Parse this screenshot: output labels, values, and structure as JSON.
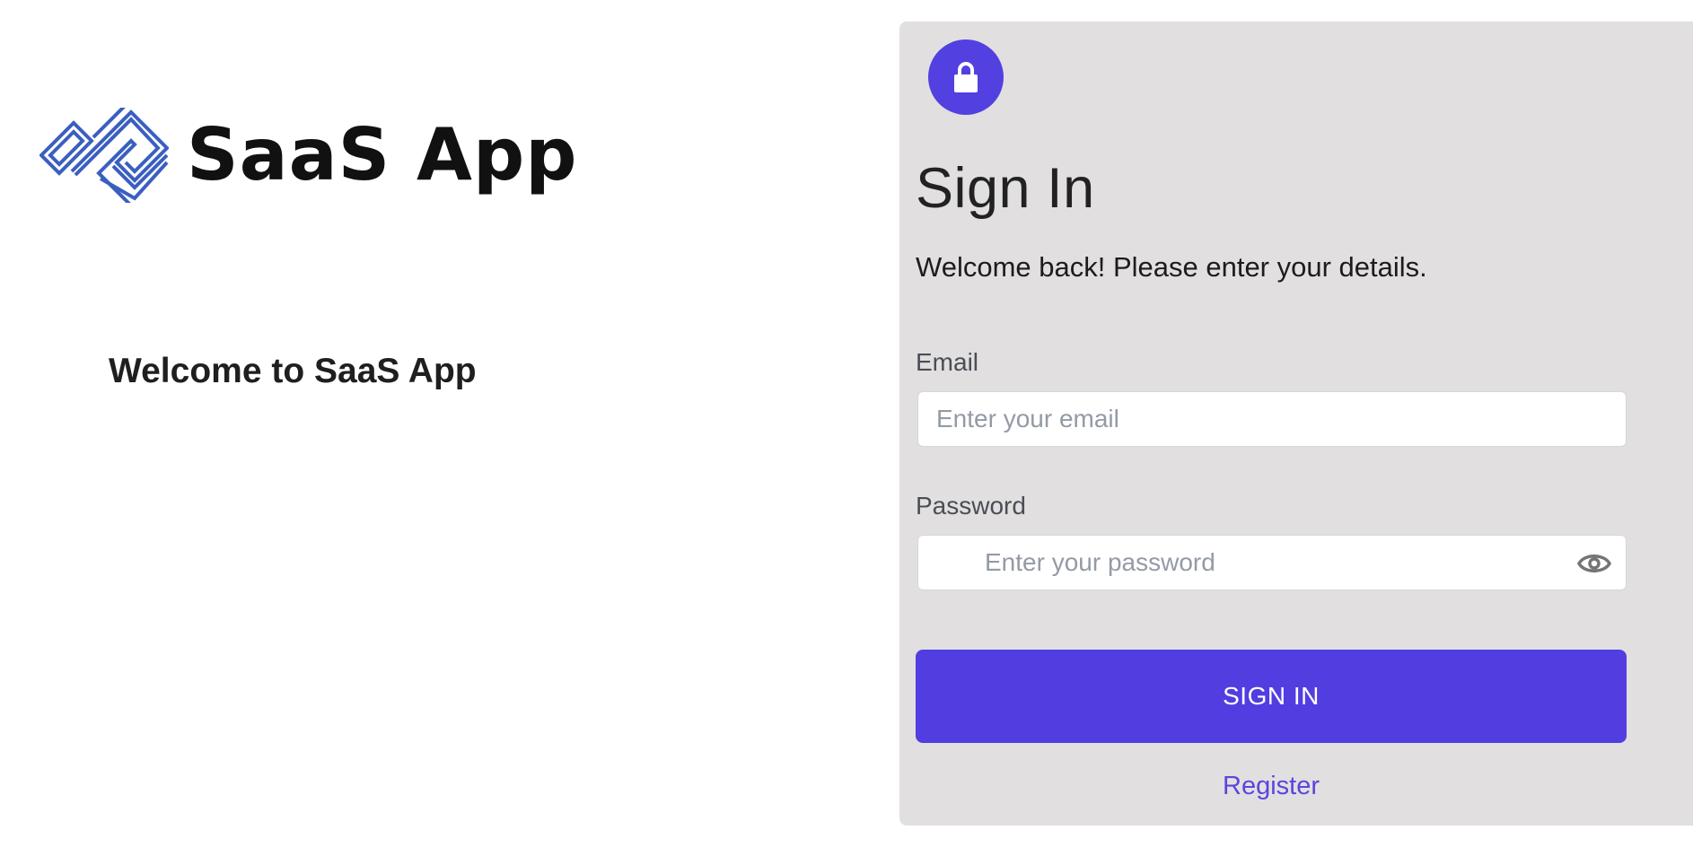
{
  "brand": {
    "name": "SaaS App",
    "logo_icon": "interlocking-diamonds-logo",
    "logo_color": "#3b5fc0"
  },
  "hero": {
    "heading": "Welcome to SaaS App"
  },
  "signin": {
    "avatar_icon": "lock-icon",
    "title": "Sign In",
    "subtitle": "Welcome back! Please enter your details.",
    "email": {
      "label": "Email",
      "placeholder": "Enter your email",
      "value": ""
    },
    "password": {
      "label": "Password",
      "placeholder": "Enter your password",
      "value": "",
      "toggle_icon": "eye-icon"
    },
    "submit_label": "SIGN IN",
    "register_label": "Register"
  },
  "colors": {
    "accent": "#523de0",
    "card_background": "#e1dfe0",
    "link": "#5a45de"
  }
}
